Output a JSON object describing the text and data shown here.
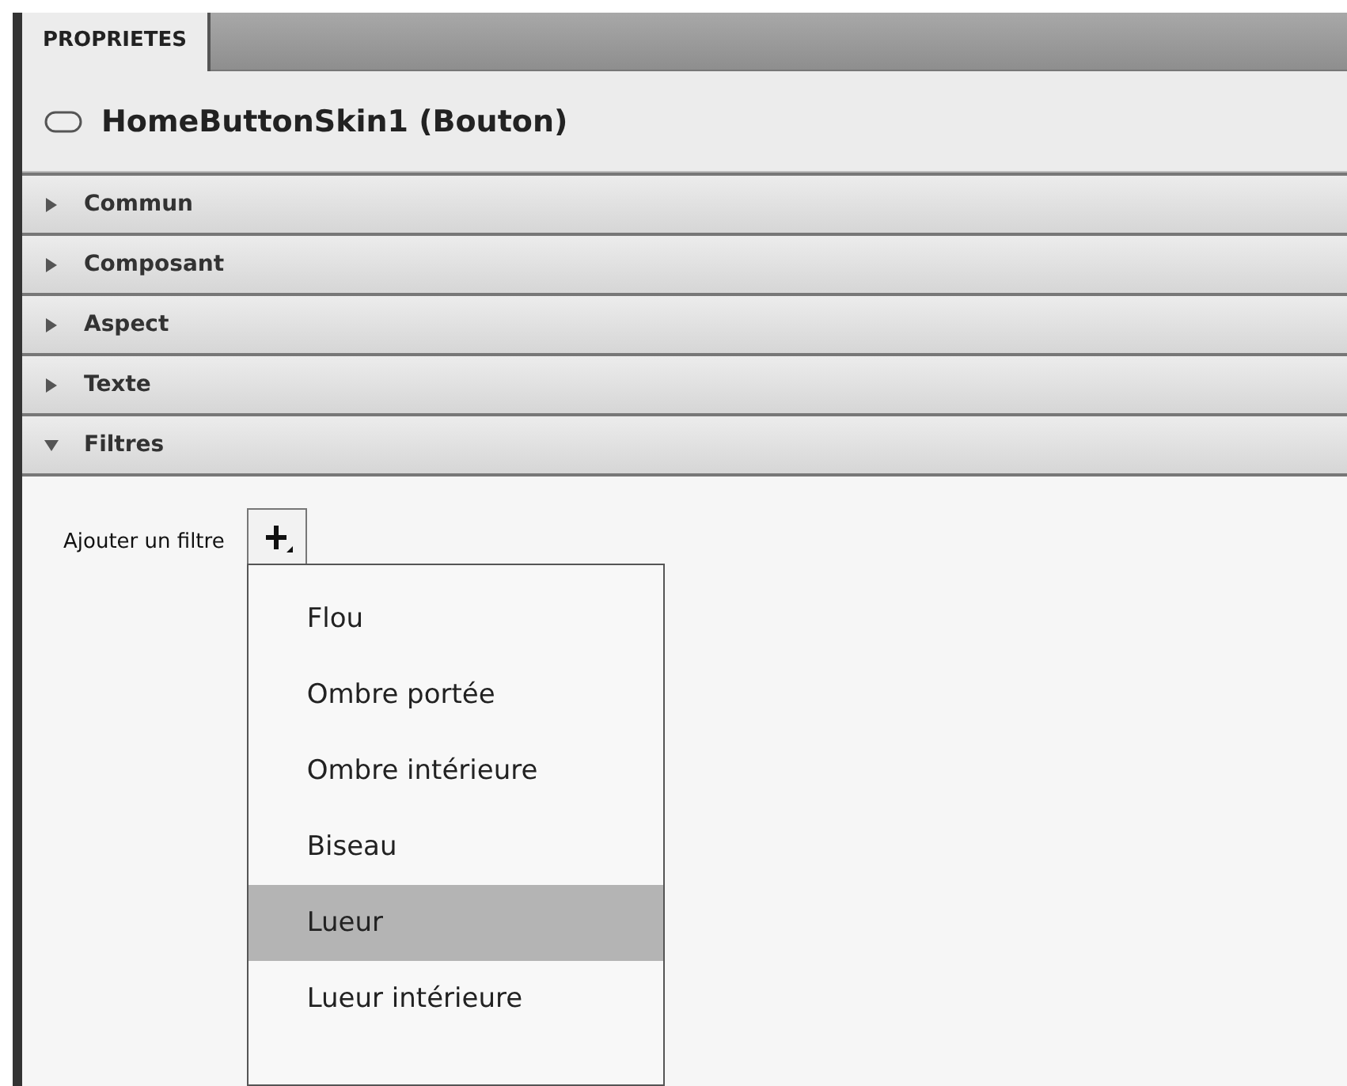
{
  "tabs": [
    {
      "label": "PROPRIETES",
      "selected": true
    }
  ],
  "header": {
    "title": "HomeButtonSkin1 (Bouton)"
  },
  "sections": [
    {
      "label": "Commun",
      "expanded": false
    },
    {
      "label": "Composant",
      "expanded": false
    },
    {
      "label": "Aspect",
      "expanded": false
    },
    {
      "label": "Texte",
      "expanded": false
    },
    {
      "label": "Filtres",
      "expanded": true
    }
  ],
  "filters": {
    "label": "Ajouter un filtre",
    "menu": [
      {
        "label": "Flou",
        "selected": false
      },
      {
        "label": "Ombre portée",
        "selected": false
      },
      {
        "label": "Ombre intérieure",
        "selected": false
      },
      {
        "label": "Biseau",
        "selected": false
      },
      {
        "label": "Lueur",
        "selected": true
      },
      {
        "label": "Lueur intérieure",
        "selected": false
      }
    ]
  }
}
